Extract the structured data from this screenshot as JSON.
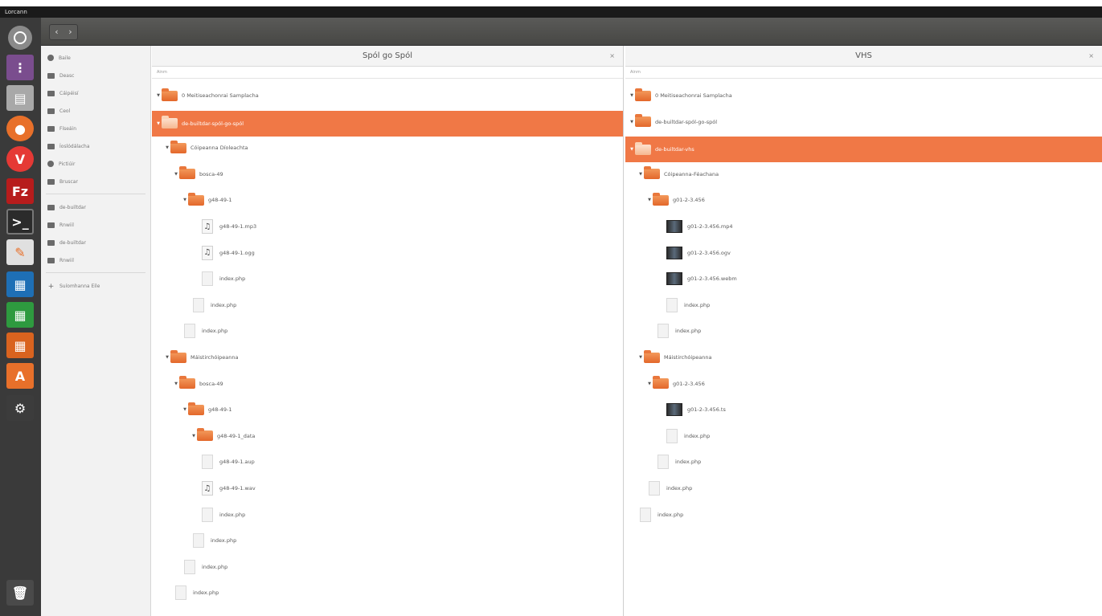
{
  "menubar": {
    "title": "Lorcann"
  },
  "nav": {
    "back": "‹",
    "forward": "›"
  },
  "sidebar": {
    "items": [
      {
        "label": "Baile",
        "icon": "clock-icon"
      },
      {
        "label": "Deasc",
        "icon": "folder-icon"
      },
      {
        "label": "Cáipéisí",
        "icon": "document-icon"
      },
      {
        "label": "Ceol",
        "icon": "music-icon"
      },
      {
        "label": "Físeáin",
        "icon": "video-icon"
      },
      {
        "label": "Íoslódálacha",
        "icon": "download-icon"
      },
      {
        "label": "Pictiúir",
        "icon": "camera-icon"
      },
      {
        "label": "Bruscar",
        "icon": "trash-icon"
      }
    ],
    "bookmarks": [
      {
        "label": "de-builtdar",
        "icon": "folder-icon"
      },
      {
        "label": "Rnwiil",
        "icon": "folder-icon"
      },
      {
        "label": "de-builtdar",
        "icon": "folder-icon"
      },
      {
        "label": "Rnwiil",
        "icon": "folder-icon"
      }
    ],
    "other": {
      "label": "Suíomhanna Eile",
      "icon": "plus-icon"
    }
  },
  "left_pane": {
    "title": "Spól go Spól",
    "close": "×",
    "column": "Ainm",
    "rows": [
      {
        "label": "0 Meitiseachonrai Samplacha",
        "type": "folder",
        "depth": 0
      },
      {
        "label": "de-builtdar-spól-go-spól",
        "type": "folder",
        "depth": 0,
        "selected": true
      },
      {
        "label": "Cóipeanna Díoleachta",
        "type": "folder",
        "depth": 1
      },
      {
        "label": "bosca-49",
        "type": "folder",
        "depth": 2
      },
      {
        "label": "g48-49-1",
        "type": "folder",
        "depth": 3
      },
      {
        "label": "g48-49-1.mp3",
        "type": "audio",
        "depth": 4
      },
      {
        "label": "g48-49-1.ogg",
        "type": "audio",
        "depth": 4
      },
      {
        "label": "index.php",
        "type": "file",
        "depth": 4
      },
      {
        "label": "index.php",
        "type": "file",
        "depth": 3
      },
      {
        "label": "index.php",
        "type": "file",
        "depth": 2
      },
      {
        "label": "Máistirchóipeanna",
        "type": "folder",
        "depth": 1
      },
      {
        "label": "bosca-49",
        "type": "folder",
        "depth": 2
      },
      {
        "label": "g48-49-1",
        "type": "folder",
        "depth": 3
      },
      {
        "label": "g48-49-1_data",
        "type": "folder",
        "depth": 4
      },
      {
        "label": "g48-49-1.aup",
        "type": "file",
        "depth": 4
      },
      {
        "label": "g48-49-1.wav",
        "type": "audio",
        "depth": 4
      },
      {
        "label": "index.php",
        "type": "file",
        "depth": 4
      },
      {
        "label": "index.php",
        "type": "file",
        "depth": 3
      },
      {
        "label": "index.php",
        "type": "file",
        "depth": 2
      },
      {
        "label": "index.php",
        "type": "file",
        "depth": 1
      }
    ]
  },
  "right_pane": {
    "title": "VHS",
    "close": "×",
    "column": "Ainm",
    "rows": [
      {
        "label": "0 Meitiseachonrai Samplacha",
        "type": "folder",
        "depth": 0
      },
      {
        "label": "de-builtdar-spól-go-spól",
        "type": "folder",
        "depth": 0
      },
      {
        "label": "de-builtdar-vhs",
        "type": "folder",
        "depth": 0,
        "selected": true
      },
      {
        "label": "Cóipeanna-Féachana",
        "type": "folder",
        "depth": 1
      },
      {
        "label": "g01-2-3.456",
        "type": "folder",
        "depth": 2
      },
      {
        "label": "g01-2-3.456.mp4",
        "type": "video",
        "depth": 3
      },
      {
        "label": "g01-2-3.456.ogv",
        "type": "video",
        "depth": 3
      },
      {
        "label": "g01-2-3.456.webm",
        "type": "video",
        "depth": 3
      },
      {
        "label": "index.php",
        "type": "file",
        "depth": 3
      },
      {
        "label": "index.php",
        "type": "file",
        "depth": 2
      },
      {
        "label": "Máistirchóipeanna",
        "type": "folder",
        "depth": 1
      },
      {
        "label": "g01-2-3.456",
        "type": "folder",
        "depth": 2
      },
      {
        "label": "g01-2-3.456.ts",
        "type": "video",
        "depth": 3
      },
      {
        "label": "index.php",
        "type": "file",
        "depth": 3
      },
      {
        "label": "index.php",
        "type": "file",
        "depth": 2
      },
      {
        "label": "index.php",
        "type": "file",
        "depth": 1
      },
      {
        "label": "index.php",
        "type": "file",
        "depth": 0
      }
    ]
  }
}
